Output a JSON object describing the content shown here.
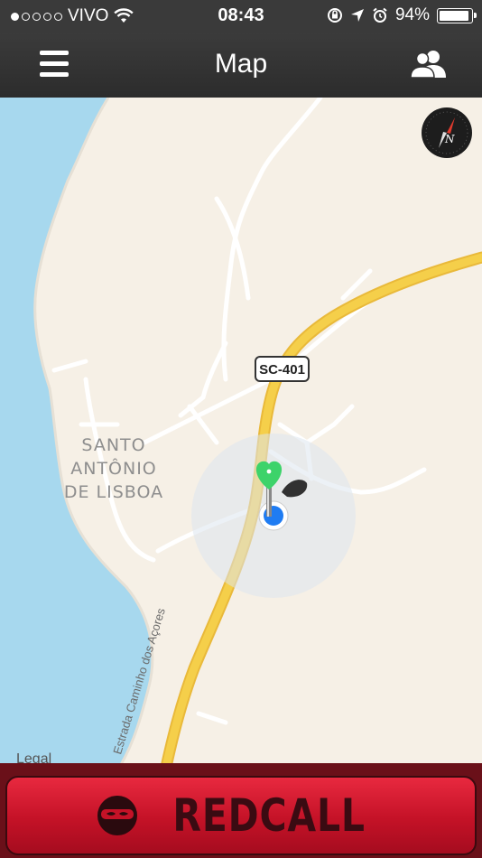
{
  "status_bar": {
    "carrier": "VIVO",
    "time": "08:43",
    "battery_percent": "94%",
    "signal_bars": 1,
    "signal_total": 5
  },
  "nav": {
    "title": "Map",
    "menu_icon": "hamburger-menu-icon",
    "friends_icon": "friends-icon"
  },
  "map": {
    "road_shield": "SC-401",
    "town_label_1": "SANTO",
    "town_label_2": "ANTÔNIO",
    "town_label_3": "DE LISBOA",
    "street_label": "Estrada Caminho dos Açores",
    "legal": "Legal",
    "compass_icon": "compass-icon",
    "colors": {
      "land": "#f6f0e6",
      "water": "#a7d8ee",
      "highway": "#f5cf4a",
      "road": "#ffffff",
      "user_dot": "#1f7cf2",
      "pin": "#3dd36a"
    }
  },
  "redcall": {
    "label": "REDCALL",
    "logo_icon": "ninja-mask-icon",
    "color": "#d3152f"
  }
}
